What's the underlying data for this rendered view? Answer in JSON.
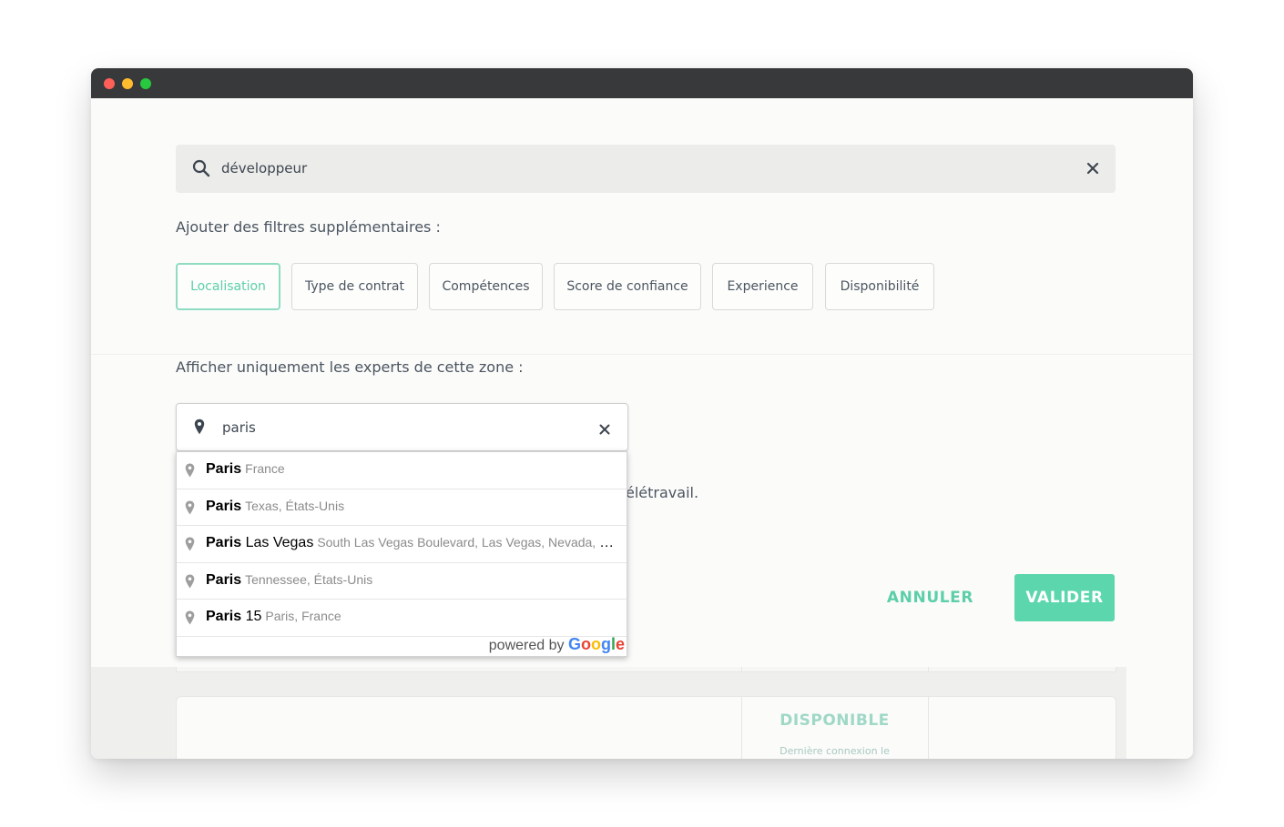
{
  "search": {
    "query": "développeur",
    "icon": "search-icon",
    "clear_icon": "close-icon"
  },
  "filters": {
    "label": "Ajouter des filtres supplémentaires :",
    "chips": [
      {
        "label": "Localisation",
        "active": true
      },
      {
        "label": "Type de contrat",
        "active": false
      },
      {
        "label": "Compétences",
        "active": false
      },
      {
        "label": "Score de confiance",
        "active": false
      },
      {
        "label": "Experience",
        "active": false
      },
      {
        "label": "Disponibilité",
        "active": false
      }
    ]
  },
  "zone": {
    "label": "Afficher uniquement les experts de cette zone :",
    "input_value": "paris",
    "partial_hidden_text": "élétravail."
  },
  "autocomplete": {
    "items": [
      {
        "main_bold": "Paris",
        "main_rest": "",
        "secondary": "France"
      },
      {
        "main_bold": "Paris",
        "main_rest": "",
        "secondary": "Texas, États-Unis"
      },
      {
        "main_bold": "Paris",
        "main_rest": " Las Vegas",
        "secondary": "South Las Vegas Boulevard, Las Vegas, Nevada, États-Unis"
      },
      {
        "main_bold": "Paris",
        "main_rest": "",
        "secondary": "Tennessee, États-Unis"
      },
      {
        "main_bold": "Paris",
        "main_rest": " 15",
        "secondary": "Paris, France"
      }
    ],
    "powered_by": "powered by",
    "google_letters": [
      "G",
      "o",
      "o",
      "g",
      "l",
      "e"
    ]
  },
  "actions": {
    "cancel_label": "ANNULER",
    "validate_label": "VALIDER"
  },
  "background": {
    "status": "DISPONIBLE",
    "last_connection": "Dernière connexion le"
  },
  "colors": {
    "accent": "#5bd6ad",
    "titlebar": "#38393b"
  }
}
